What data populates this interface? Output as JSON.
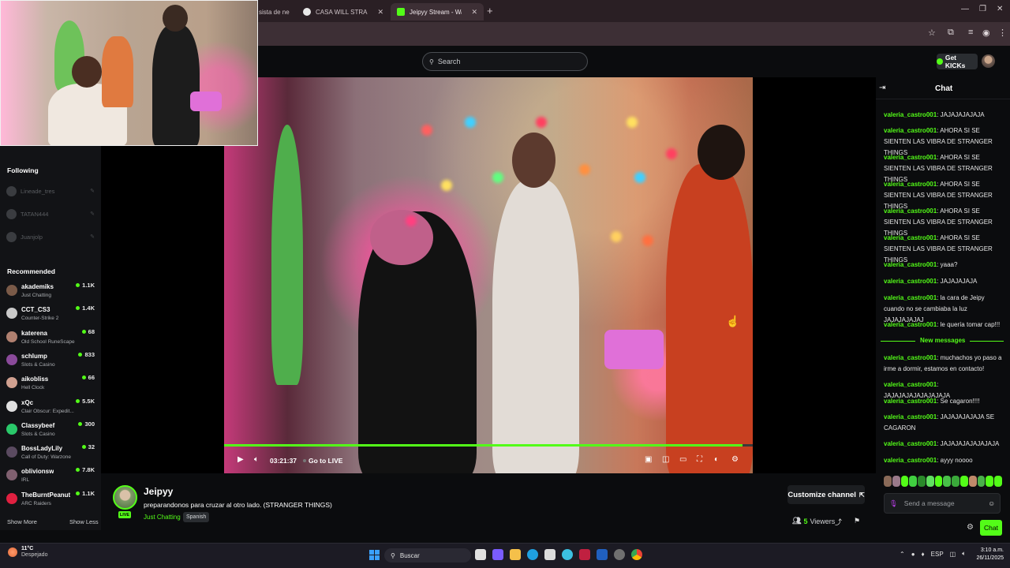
{
  "browser": {
    "tabs": [
      {
        "label": "sista de ne",
        "active": false
      },
      {
        "label": "CASA WILL STRANGER) - Busca",
        "active": false
      },
      {
        "label": "Jeipyy Stream - Watch Live on K",
        "active": true
      }
    ],
    "new_tab_icon": "plus-icon",
    "window_controls": [
      "minimize-icon",
      "restore-icon",
      "close-icon"
    ]
  },
  "header": {
    "search_placeholder": "Search",
    "get_kicks_label": "Get KICKs"
  },
  "sidebar": {
    "following_heading": "Following",
    "following": [
      {
        "name": "Lineade_tres"
      },
      {
        "name": "TATAN444"
      },
      {
        "name": "Juanjolp"
      }
    ],
    "recommended_heading": "Recommended",
    "recommended": [
      {
        "name": "akademiks",
        "category": "Just Chatting",
        "viewers": "1.1K",
        "color": "#7a5a48"
      },
      {
        "name": "CCT_CS3",
        "category": "Counter-Strike 2",
        "viewers": "1.4K",
        "color": "#c9c9c9"
      },
      {
        "name": "katerena",
        "category": "Old School RuneScape",
        "viewers": "68",
        "color": "#b08070"
      },
      {
        "name": "schlump",
        "category": "Slots & Casino",
        "viewers": "833",
        "color": "#8a4a9a"
      },
      {
        "name": "aikobliss",
        "category": "Hell Clock",
        "viewers": "66",
        "color": "#d0a090"
      },
      {
        "name": "xQc",
        "category": "Clair Obscur: Expedit...",
        "viewers": "5.5K",
        "color": "#e0e0e0"
      },
      {
        "name": "Classybeef",
        "category": "Slots & Casino",
        "viewers": "300",
        "color": "#2ac86a"
      },
      {
        "name": "BossLadyLily",
        "category": "Call of Duty: Warzone",
        "viewers": "32",
        "color": "#5a4a60"
      },
      {
        "name": "oblivionsw",
        "category": "IRL",
        "viewers": "7.8K",
        "color": "#806070"
      },
      {
        "name": "TheBurntPeanut",
        "category": "ARC Raiders",
        "viewers": "1.1K",
        "color": "#e02040"
      }
    ],
    "show_more": "Show More",
    "show_less": "Show Less"
  },
  "player": {
    "timecode": "03:21:37",
    "go_live": "Go to LIVE",
    "progress": 0.98
  },
  "stream": {
    "streamer": "Jeipyy",
    "title": "preparandonos para cruzar al otro lado. (STRANGER THINGS)",
    "category": "Just Chatting",
    "language": "Spanish",
    "live_badge": "LIVE",
    "customize_label": "Customize channel",
    "viewers_count": "5",
    "viewers_word": "Viewers"
  },
  "chat": {
    "title": "Chat",
    "messages": [
      {
        "user": "valeria_castro001",
        "text": "JAJAJAJAJAJA"
      },
      {
        "user": "valeria_castro001",
        "text": "AHORA SI SE SIENTEN LAS VIBRA DE STRANGER THINGS"
      },
      {
        "user": "valeria_castro001",
        "text": "AHORA SI SE SIENTEN LAS VIBRA DE STRANGER THINGS"
      },
      {
        "user": "valeria_castro001",
        "text": "AHORA SI SE SIENTEN LAS VIBRA DE STRANGER THINGS"
      },
      {
        "user": "valeria_castro001",
        "text": "AHORA SI SE SIENTEN LAS VIBRA DE STRANGER THINGS"
      },
      {
        "user": "valeria_castro001",
        "text": "AHORA SI SE SIENTEN LAS VIBRA DE STRANGER THINGS"
      },
      {
        "user": "valeria_castro001",
        "text": "yaaa?"
      },
      {
        "user": "valeria_castro001",
        "text": "JAJAJAJAJA"
      },
      {
        "user": "valeria_castro001",
        "text": "la cara de Jeipy cuando no se cambiaba la luz JAJAJAJAJAJ"
      },
      {
        "user": "valeria_castro001",
        "text": "le quería tomar cap!!!"
      }
    ],
    "new_messages_label": "New messages",
    "new_messages": [
      {
        "user": "valeria_castro001",
        "text": "muchachos yo paso a irme a dormir, estamos en contacto!"
      },
      {
        "user": "valeria_castro001",
        "text": "JAJAJAJAJAJAJAJAJA"
      },
      {
        "user": "valeria_castro001",
        "text": "Se cagaron!!!!"
      },
      {
        "user": "valeria_castro001",
        "text": "JAJAJAJAJAJA SE CAGARON"
      },
      {
        "user": "valeria_castro001",
        "text": "JAJAJAJAJAJAJAJA"
      },
      {
        "user": "valeria_castro001",
        "text": "ayyy noooo"
      }
    ],
    "input_placeholder": "Send a message",
    "send_label": "Chat"
  },
  "taskbar": {
    "weather_temp": "11°C",
    "weather_desc": "Despejado",
    "search_label": "Buscar",
    "lang": "ESP",
    "time": "3:10 a.m.",
    "date": "26/11/2025"
  }
}
